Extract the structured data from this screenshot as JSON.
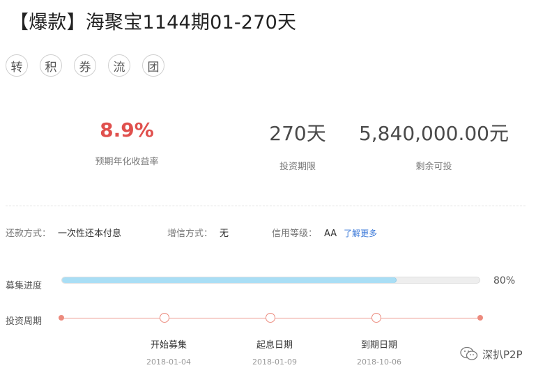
{
  "header": {
    "title": "【爆款】海聚宝1144期01-270天"
  },
  "tags": [
    "转",
    "积",
    "券",
    "流",
    "团"
  ],
  "stats": {
    "rate": {
      "value": "8.9%",
      "label": "预期年化收益率"
    },
    "term": {
      "value": "270天",
      "label": "投资期限"
    },
    "remaining": {
      "value": "5,840,000.00元",
      "label": "剩余可投"
    }
  },
  "info": {
    "repay_label": "还款方式：",
    "repay_value": "一次性还本付息",
    "guarantee_label": "增信方式：",
    "guarantee_value": "无",
    "credit_label": "信用等级：",
    "credit_value": "AA",
    "credit_link": "了解更多"
  },
  "progress": {
    "label": "募集进度",
    "percent_text": "80%",
    "fraction": 0.8
  },
  "period": {
    "label": "投资周期",
    "milestones": [
      {
        "label": "开始募集",
        "date": "2018-01-04"
      },
      {
        "label": "起息日期",
        "date": "2018-01-09"
      },
      {
        "label": "到期日期",
        "date": "2018-10-06"
      }
    ]
  },
  "watermark": {
    "text": "深扒P2P"
  },
  "colors": {
    "accent_red": "#e0504d",
    "progress_fill": "#a9def5",
    "timeline": "#ec8a7d",
    "link": "#3a78d8"
  }
}
